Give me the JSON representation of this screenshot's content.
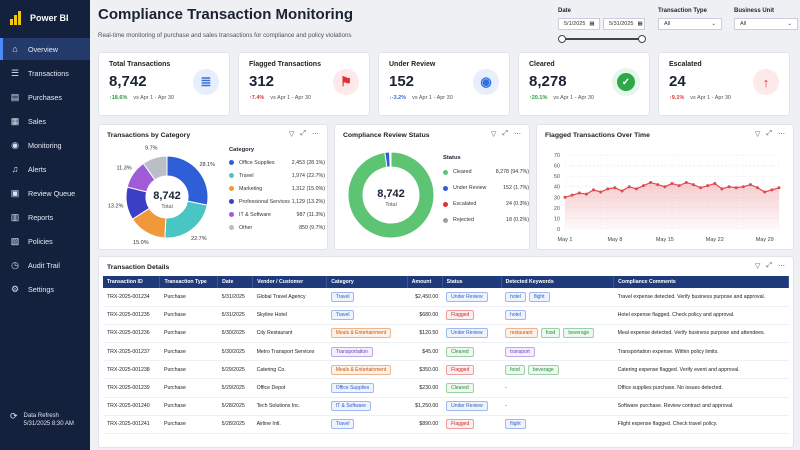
{
  "app": {
    "name": "Power BI"
  },
  "sidebar": {
    "items": [
      {
        "label": "Overview",
        "icon": "home-icon",
        "glyph": "⌂",
        "active": true
      },
      {
        "label": "Transactions",
        "icon": "list-icon",
        "glyph": "☰"
      },
      {
        "label": "Purchases",
        "icon": "cart-icon",
        "glyph": "▤"
      },
      {
        "label": "Sales",
        "icon": "sales-icon",
        "glyph": "▦"
      },
      {
        "label": "Monitoring",
        "icon": "monitor-icon",
        "glyph": "◉"
      },
      {
        "label": "Alerts",
        "icon": "bell-icon",
        "glyph": "♫"
      },
      {
        "label": "Review Queue",
        "icon": "queue-icon",
        "glyph": "▣"
      },
      {
        "label": "Reports",
        "icon": "report-icon",
        "glyph": "▥"
      },
      {
        "label": "Policies",
        "icon": "policy-icon",
        "glyph": "▧"
      },
      {
        "label": "Audit Trail",
        "icon": "audit-icon",
        "glyph": "◷"
      },
      {
        "label": "Settings",
        "icon": "gear-icon",
        "glyph": "⚙"
      }
    ],
    "refresh": {
      "label": "Data Refresh",
      "value": "5/31/2025 8:30 AM"
    }
  },
  "header": {
    "title": "Compliance Transaction Monitoring",
    "subtitle": "Real-time monitoring of purchase and sales transactions for compliance and policy violations"
  },
  "filters": {
    "date": {
      "label": "Date",
      "start": "5/1/2025",
      "end": "5/31/2025"
    },
    "transaction_type": {
      "label": "Transaction Type",
      "value": "All"
    },
    "business_unit": {
      "label": "Business Unit",
      "value": "All"
    }
  },
  "kpis": [
    {
      "title": "Total Transactions",
      "value": "8,742",
      "delta": "18.6%",
      "arrow": "↑",
      "delta_color": "#2b9a3f",
      "period": "vs Apr 1 - Apr 30",
      "icon": "document-icon",
      "glyph": "≣",
      "icon_color": "#3a6fd8",
      "icon_bg": "#e7eefc"
    },
    {
      "title": "Flagged Transactions",
      "value": "312",
      "delta": "7.4%",
      "arrow": "↑",
      "delta_color": "#d13b3b",
      "period": "vs Apr 1 - Apr 30",
      "icon": "flag-icon",
      "glyph": "⚑",
      "icon_color": "#e03131",
      "icon_bg": "#fde9e9"
    },
    {
      "title": "Under Review",
      "value": "152",
      "delta": "-3.2%",
      "arrow": "↓",
      "delta_color": "#3a6fd8",
      "period": "vs Apr 1 - Apr 30",
      "icon": "eye-icon",
      "glyph": "◉",
      "icon_color": "#2f6fe0",
      "icon_bg": "#e7eefc"
    },
    {
      "title": "Cleared",
      "value": "8,278",
      "delta": "20.1%",
      "arrow": "↑",
      "delta_color": "#2b9a3f",
      "period": "vs Apr 1 - Apr 30",
      "icon": "shield-check-icon",
      "glyph": "✓",
      "icon_color": "#ffffff",
      "icon_bg": "#e6f6ea"
    },
    {
      "title": "Escalated",
      "value": "24",
      "delta": "9.1%",
      "arrow": "↑",
      "delta_color": "#d13b3b",
      "period": "vs Apr 1 - Apr 30",
      "icon": "arrow-up-icon",
      "glyph": "↑",
      "icon_color": "#e03131",
      "icon_bg": "#fde9e9"
    }
  ],
  "category_panel": {
    "title": "Transactions by Category",
    "center_value": "8,742",
    "center_label": "Total",
    "legend_title": "Category"
  },
  "review_panel": {
    "title": "Compliance Review Status",
    "center_value": "8,742",
    "center_label": "Total",
    "legend_title": "Status"
  },
  "flagged_panel": {
    "title": "Flagged Transactions Over Time"
  },
  "table_panel": {
    "title": "Transaction Details",
    "columns": [
      "Transaction ID",
      "Transaction Type",
      "Date",
      "Vendor / Customer",
      "Category",
      "Amount",
      "Status",
      "Detected Keywords",
      "Compliance Comments"
    ],
    "rows": [
      {
        "id": "TRX-2025-001234",
        "type": "Purchase",
        "date": "5/31/2025",
        "vendor": "Global Travel Agency",
        "category": "Travel",
        "cat_style": "blue",
        "amount": "$2,450.00",
        "status": "Under Review",
        "st_style": "blue",
        "keywords": [
          {
            "t": "hotel",
            "s": "blue"
          },
          {
            "t": "flight",
            "s": "blue"
          }
        ],
        "comment": "Travel expense detected. Verify business purpose and approval."
      },
      {
        "id": "TRX-2025-001235",
        "type": "Purchase",
        "date": "5/31/2025",
        "vendor": "Skyline Hotel",
        "category": "Travel",
        "cat_style": "blue",
        "amount": "$680.00",
        "status": "Flagged",
        "st_style": "red",
        "keywords": [
          {
            "t": "hotel",
            "s": "blue"
          }
        ],
        "comment": "Hotel expense flagged. Check policy and approval."
      },
      {
        "id": "TRX-2025-001236",
        "type": "Purchase",
        "date": "5/30/2025",
        "vendor": "City Restaurant",
        "category": "Meals & Entertainment",
        "cat_style": "orange",
        "amount": "$120.50",
        "status": "Under Review",
        "st_style": "blue",
        "keywords": [
          {
            "t": "restaurant",
            "s": "orange"
          },
          {
            "t": "food",
            "s": "green"
          },
          {
            "t": "beverage",
            "s": "green"
          }
        ],
        "comment": "Meal expense detected. Verify business purpose and attendees."
      },
      {
        "id": "TRX-2025-001237",
        "type": "Purchase",
        "date": "5/30/2025",
        "vendor": "Metro Transport Services",
        "category": "Transportation",
        "cat_style": "purple",
        "amount": "$45.00",
        "status": "Cleared",
        "st_style": "green",
        "keywords": [
          {
            "t": "transport",
            "s": "purple"
          }
        ],
        "comment": "Transportation expense. Within policy limits."
      },
      {
        "id": "TRX-2025-001238",
        "type": "Purchase",
        "date": "5/29/2025",
        "vendor": "Catering Co.",
        "category": "Meals & Entertainment",
        "cat_style": "orange",
        "amount": "$350.00",
        "status": "Flagged",
        "st_style": "red",
        "keywords": [
          {
            "t": "food",
            "s": "green"
          },
          {
            "t": "beverage",
            "s": "green"
          }
        ],
        "comment": "Catering expense flagged. Verify event and approval."
      },
      {
        "id": "TRX-2025-001239",
        "type": "Purchase",
        "date": "5/29/2025",
        "vendor": "Office Depot",
        "category": "Office Supplies",
        "cat_style": "blue",
        "amount": "$230.00",
        "status": "Cleared",
        "st_style": "green",
        "keywords": [
          {
            "t": "-",
            "s": "none"
          }
        ],
        "comment": "Office supplies purchase. No issues detected."
      },
      {
        "id": "TRX-2025-001240",
        "type": "Purchase",
        "date": "5/28/2025",
        "vendor": "Tech Solutions Inc.",
        "category": "IT & Software",
        "cat_style": "blue",
        "amount": "$1,250.00",
        "status": "Under Review",
        "st_style": "blue",
        "keywords": [
          {
            "t": "-",
            "s": "none"
          }
        ],
        "comment": "Software purchase. Review contract and approval."
      },
      {
        "id": "TRX-2025-001241",
        "type": "Purchase",
        "date": "5/28/2025",
        "vendor": "Airline Intl.",
        "category": "Travel",
        "cat_style": "blue",
        "amount": "$890.00",
        "status": "Flagged",
        "st_style": "red",
        "keywords": [
          {
            "t": "flight",
            "s": "blue"
          }
        ],
        "comment": "Flight expense flagged. Check travel policy."
      }
    ]
  },
  "chart_data": [
    {
      "type": "pie",
      "title": "Transactions by Category",
      "legend_title": "Category",
      "categories": [
        "Office Supplies",
        "Travel",
        "Marketing",
        "Professional Services",
        "IT & Software",
        "Other"
      ],
      "values": [
        2453,
        1974,
        1312,
        1129,
        987,
        850
      ],
      "value_labels": [
        "2,453 (28.1%)",
        "1,974 (22.7%)",
        "1,312 (15.0%)",
        "1,129 (13.2%)",
        "987 (11.3%)",
        "850 (9.7%)"
      ],
      "slice_labels": [
        "28.1%",
        "22.7%",
        "15.0%",
        "13.2%",
        "11.3%",
        "9.7%"
      ],
      "colors": [
        "#2f5fd6",
        "#49c5c3",
        "#f0993a",
        "#3b3fc4",
        "#a05bd8",
        "#b9bec7"
      ],
      "center_value": "8,742",
      "center_label": "Total"
    },
    {
      "type": "pie",
      "title": "Compliance Review Status",
      "legend_title": "Status",
      "categories": [
        "Cleared",
        "Under Review",
        "Escalated",
        "Rejected"
      ],
      "values": [
        8278,
        152,
        24,
        18
      ],
      "value_labels": [
        "8,278 (94.7%)",
        "152 (1.7%)",
        "24 (0.3%)",
        "18 (0.2%)"
      ],
      "colors": [
        "#5cc472",
        "#2f5fd6",
        "#e03131",
        "#9aa0ab"
      ],
      "center_value": "8,742",
      "center_label": "Total"
    },
    {
      "type": "area",
      "title": "Flagged Transactions Over Time",
      "x": [
        "May 1",
        "May 2",
        "May 3",
        "May 4",
        "May 5",
        "May 6",
        "May 7",
        "May 8",
        "May 9",
        "May 10",
        "May 11",
        "May 12",
        "May 13",
        "May 14",
        "May 15",
        "May 16",
        "May 17",
        "May 18",
        "May 19",
        "May 20",
        "May 21",
        "May 22",
        "May 23",
        "May 24",
        "May 25",
        "May 26",
        "May 27",
        "May 28",
        "May 29",
        "May 30",
        "May 31"
      ],
      "x_ticks": [
        "May 1",
        "May 8",
        "May 15",
        "May 22",
        "May 29"
      ],
      "values": [
        30,
        32,
        34,
        33,
        37,
        35,
        38,
        39,
        36,
        40,
        38,
        41,
        44,
        42,
        40,
        43,
        41,
        44,
        42,
        39,
        41,
        43,
        38,
        40,
        39,
        40,
        42,
        39,
        35,
        37,
        39
      ],
      "ylim": [
        0,
        70
      ],
      "y_ticks": [
        0,
        10,
        20,
        30,
        40,
        50,
        60,
        70
      ],
      "color": "#e0484f",
      "grid": true
    }
  ]
}
